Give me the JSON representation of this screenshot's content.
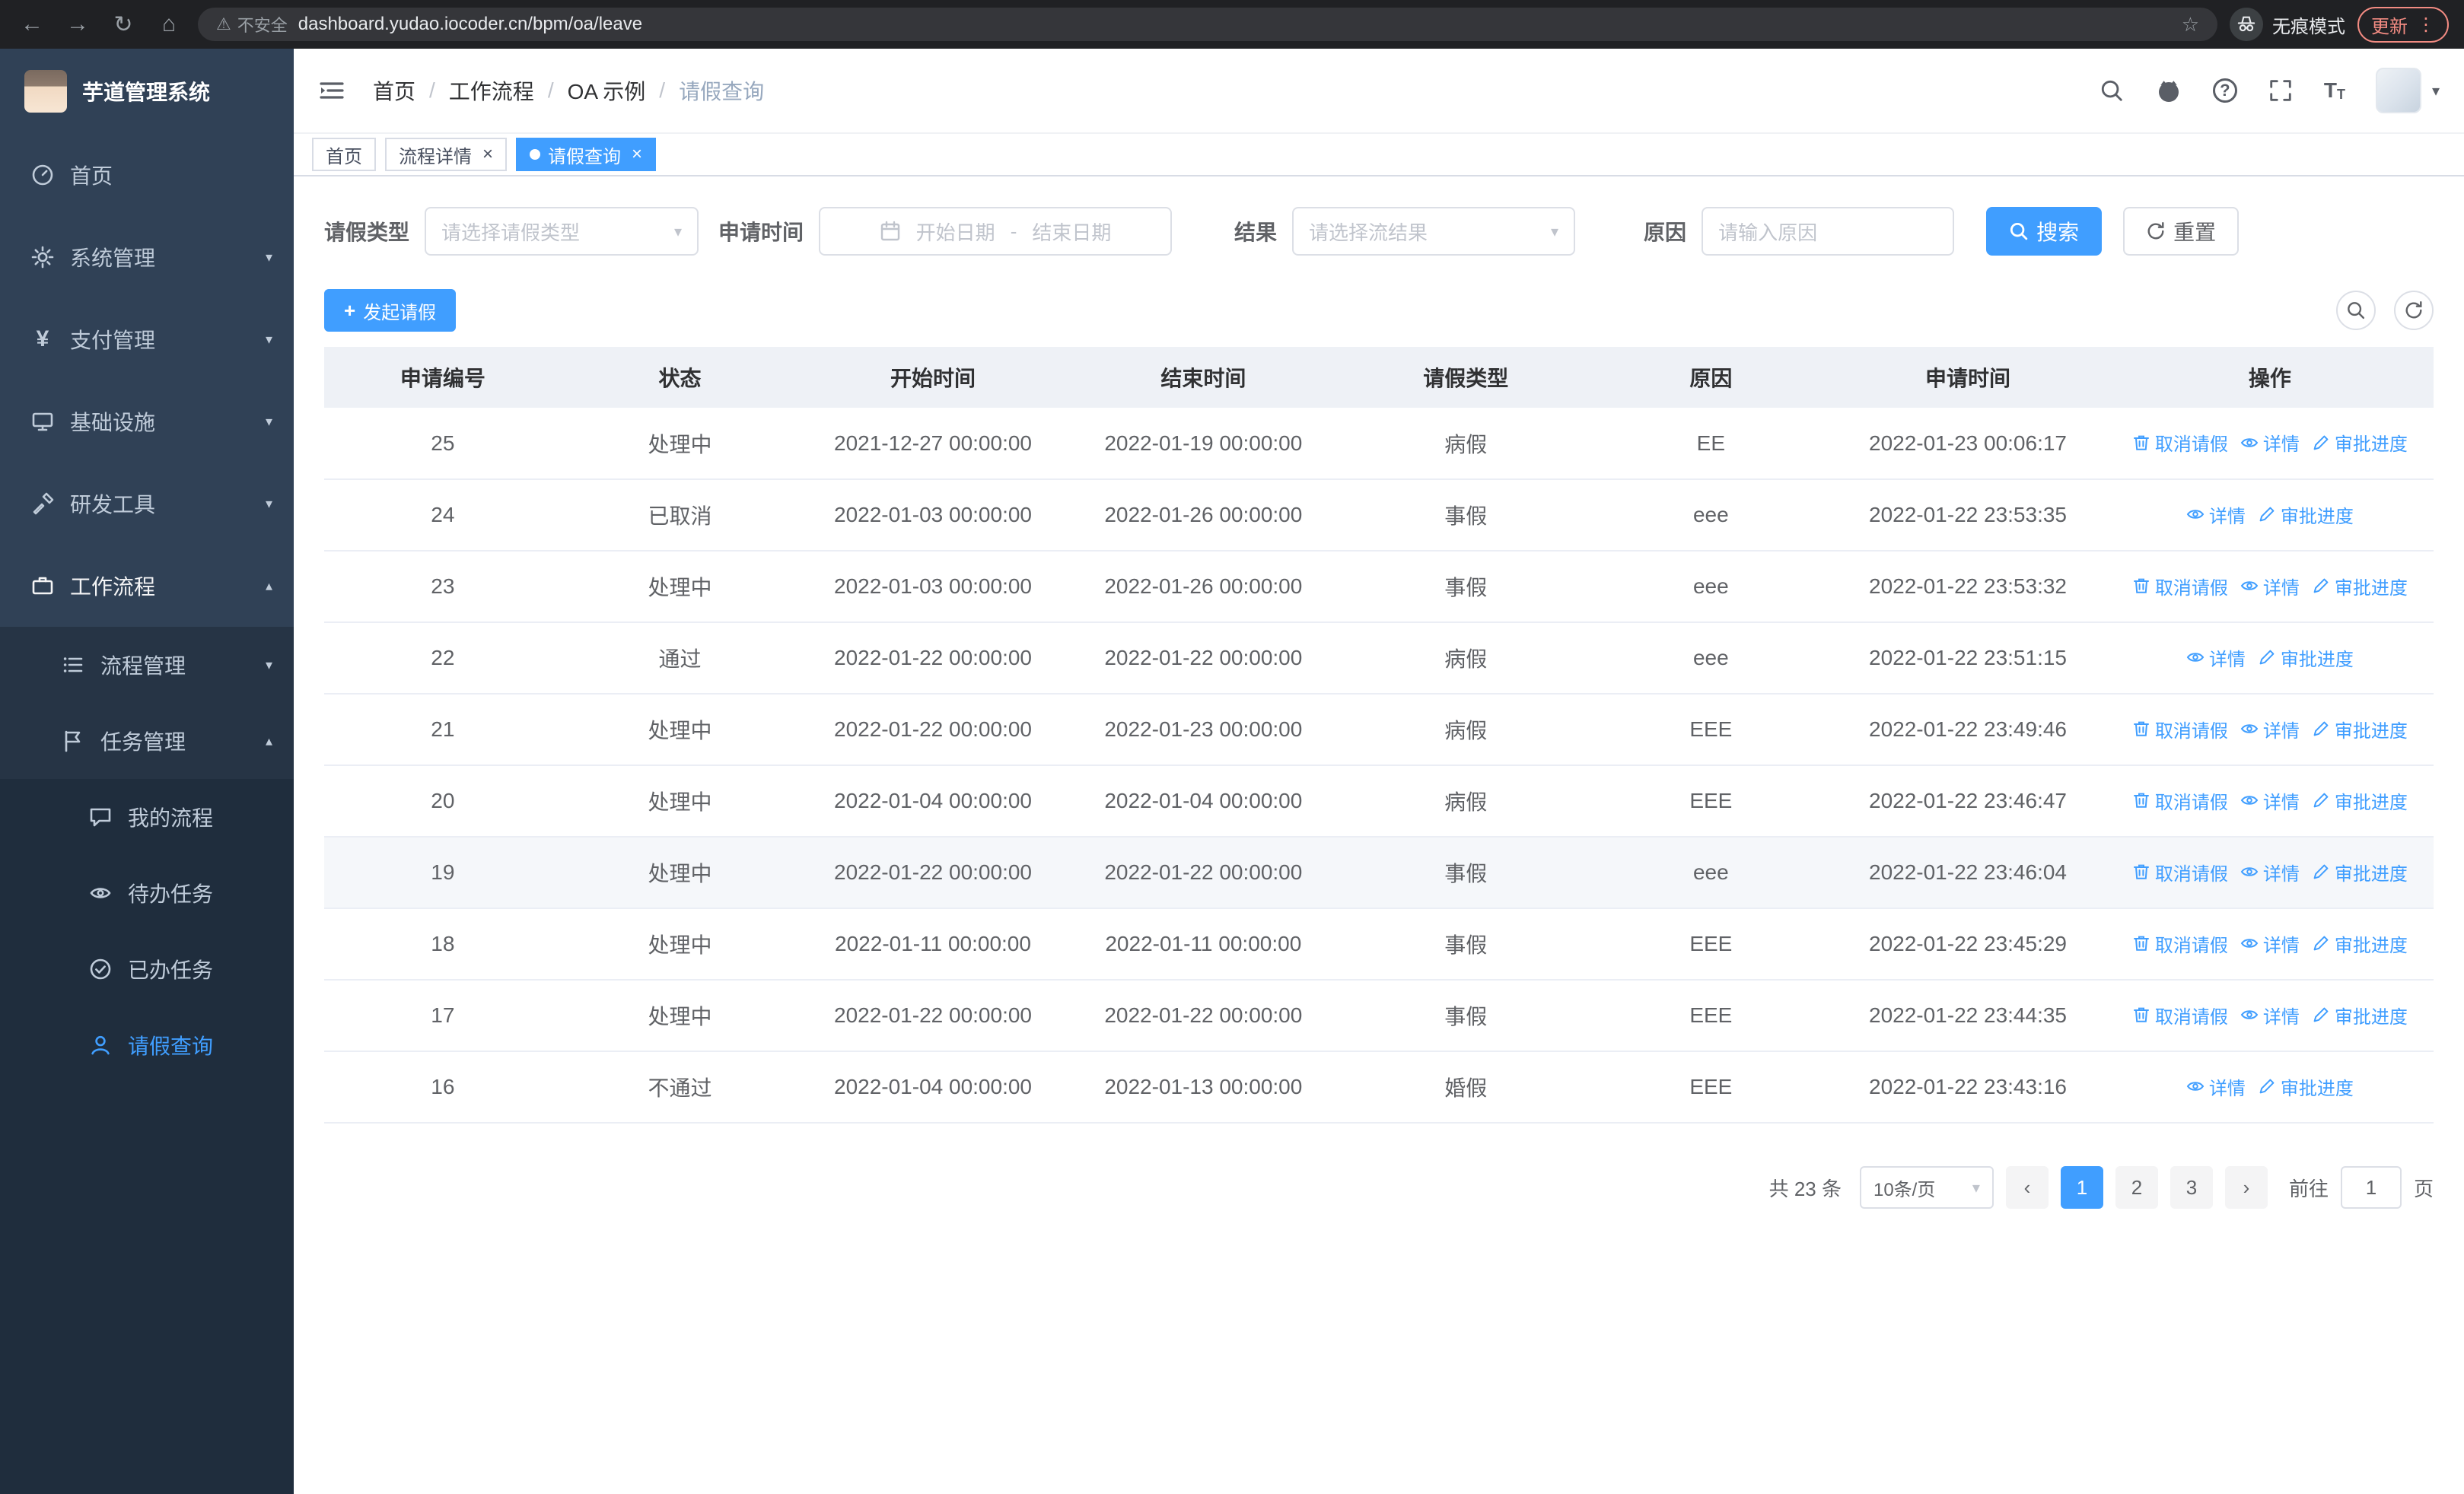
{
  "browser": {
    "security_label": "不安全",
    "url": "dashboard.yudao.iocoder.cn/bpm/oa/leave",
    "incognito_label": "无痕模式",
    "update_label": "更新"
  },
  "sidebar": {
    "title": "芋道管理系统",
    "home": "首页",
    "system": "系统管理",
    "payment": "支付管理",
    "infra": "基础设施",
    "devtools": "研发工具",
    "workflow": "工作流程",
    "process_mgmt": "流程管理",
    "task_mgmt": "任务管理",
    "my_process": "我的流程",
    "todo_task": "待办任务",
    "done_task": "已办任务",
    "leave_query": "请假查询"
  },
  "navbar": {
    "breadcrumb": [
      "首页",
      "工作流程",
      "OA 示例",
      "请假查询"
    ]
  },
  "tabs": [
    {
      "label": "首页"
    },
    {
      "label": "流程详情"
    },
    {
      "label": "请假查询"
    }
  ],
  "filters": {
    "leave_type_label": "请假类型",
    "leave_type_placeholder": "请选择请假类型",
    "apply_time_label": "申请时间",
    "start_date_placeholder": "开始日期",
    "range_separator": "-",
    "end_date_placeholder": "结束日期",
    "result_label": "结果",
    "result_placeholder": "请选择流结果",
    "reason_label": "原因",
    "reason_placeholder": "请输入原因",
    "search_label": "搜索",
    "reset_label": "重置"
  },
  "toolbar": {
    "create_label": "发起请假"
  },
  "table": {
    "headers": [
      "申请编号",
      "状态",
      "开始时间",
      "结束时间",
      "请假类型",
      "原因",
      "申请时间",
      "操作"
    ],
    "action_labels": {
      "cancel": "取消请假",
      "detail": "详情",
      "progress": "审批进度"
    },
    "rows": [
      {
        "id": "25",
        "status": "处理中",
        "start": "2021-12-27 00:00:00",
        "end": "2022-01-19 00:00:00",
        "type": "病假",
        "reason": "EE",
        "applied": "2022-01-23 00:06:17",
        "actions": [
          "cancel",
          "detail",
          "progress"
        ],
        "highlight": false
      },
      {
        "id": "24",
        "status": "已取消",
        "start": "2022-01-03 00:00:00",
        "end": "2022-01-26 00:00:00",
        "type": "事假",
        "reason": "eee",
        "applied": "2022-01-22 23:53:35",
        "actions": [
          "detail",
          "progress"
        ],
        "highlight": false
      },
      {
        "id": "23",
        "status": "处理中",
        "start": "2022-01-03 00:00:00",
        "end": "2022-01-26 00:00:00",
        "type": "事假",
        "reason": "eee",
        "applied": "2022-01-22 23:53:32",
        "actions": [
          "cancel",
          "detail",
          "progress"
        ],
        "highlight": false
      },
      {
        "id": "22",
        "status": "通过",
        "start": "2022-01-22 00:00:00",
        "end": "2022-01-22 00:00:00",
        "type": "病假",
        "reason": "eee",
        "applied": "2022-01-22 23:51:15",
        "actions": [
          "detail",
          "progress"
        ],
        "highlight": false
      },
      {
        "id": "21",
        "status": "处理中",
        "start": "2022-01-22 00:00:00",
        "end": "2022-01-23 00:00:00",
        "type": "病假",
        "reason": "EEE",
        "applied": "2022-01-22 23:49:46",
        "actions": [
          "cancel",
          "detail",
          "progress"
        ],
        "highlight": false
      },
      {
        "id": "20",
        "status": "处理中",
        "start": "2022-01-04 00:00:00",
        "end": "2022-01-04 00:00:00",
        "type": "病假",
        "reason": "EEE",
        "applied": "2022-01-22 23:46:47",
        "actions": [
          "cancel",
          "detail",
          "progress"
        ],
        "highlight": false
      },
      {
        "id": "19",
        "status": "处理中",
        "start": "2022-01-22 00:00:00",
        "end": "2022-01-22 00:00:00",
        "type": "事假",
        "reason": "eee",
        "applied": "2022-01-22 23:46:04",
        "actions": [
          "cancel",
          "detail",
          "progress"
        ],
        "highlight": true
      },
      {
        "id": "18",
        "status": "处理中",
        "start": "2022-01-11 00:00:00",
        "end": "2022-01-11 00:00:00",
        "type": "事假",
        "reason": "EEE",
        "applied": "2022-01-22 23:45:29",
        "actions": [
          "cancel",
          "detail",
          "progress"
        ],
        "highlight": false
      },
      {
        "id": "17",
        "status": "处理中",
        "start": "2022-01-22 00:00:00",
        "end": "2022-01-22 00:00:00",
        "type": "事假",
        "reason": "EEE",
        "applied": "2022-01-22 23:44:35",
        "actions": [
          "cancel",
          "detail",
          "progress"
        ],
        "highlight": false
      },
      {
        "id": "16",
        "status": "不通过",
        "start": "2022-01-04 00:00:00",
        "end": "2022-01-13 00:00:00",
        "type": "婚假",
        "reason": "EEE",
        "applied": "2022-01-22 23:43:16",
        "actions": [
          "detail",
          "progress"
        ],
        "highlight": false
      }
    ]
  },
  "pagination": {
    "total_text": "共 23 条",
    "page_size": "10条/页",
    "pages": [
      "1",
      "2",
      "3"
    ],
    "active_page": "1",
    "goto_label": "前往",
    "goto_value": "1",
    "goto_suffix": "页"
  },
  "colors": {
    "primary": "#409EFF",
    "sidebar_bg": "#304156",
    "sidebar_sub_bg": "#1f2d3d",
    "chrome_bg": "#202124"
  }
}
